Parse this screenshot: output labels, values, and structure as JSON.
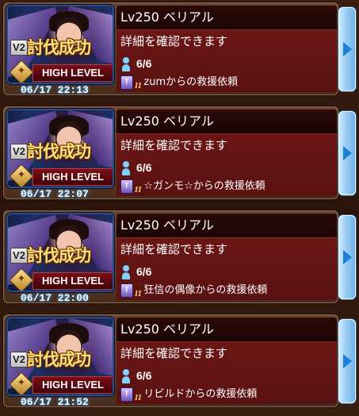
{
  "raids": [
    {
      "title": "Lv250 ベリアル",
      "detail": "詳細を確認できます",
      "participants": "6/6",
      "request": "zumからの救援依頼",
      "time": "06/17 22:13",
      "victory_label": "討伐成功",
      "version_badge": "V2",
      "level_badge": "HIGH LEVEL"
    },
    {
      "title": "Lv250 ベリアル",
      "detail": "詳細を確認できます",
      "participants": "6/6",
      "request": "☆ガンモ☆からの救援依頼",
      "time": "06/17 22:07",
      "victory_label": "討伐成功",
      "version_badge": "V2",
      "level_badge": "HIGH LEVEL"
    },
    {
      "title": "Lv250 ベリアル",
      "detail": "詳細を確認できます",
      "participants": "6/6",
      "request": "狂信の偶像からの救援依頼",
      "time": "06/17 22:00",
      "victory_label": "討伐成功",
      "version_badge": "V2",
      "level_badge": "HIGH LEVEL"
    },
    {
      "title": "Lv250 ベリアル",
      "detail": "詳細を確認できます",
      "participants": "6/6",
      "request": "リビルドからの救援依頼",
      "time": "06/17 21:52",
      "victory_label": "討伐成功",
      "version_badge": "V2",
      "level_badge": "HIGH LEVEL"
    }
  ],
  "icons": {
    "participants": "person-icon",
    "rank": "rank-badge-icon",
    "open": "arrow-right-icon"
  },
  "colors": {
    "time_glow": "#2e8dd6",
    "body_bg": "#6b1615",
    "arrow_button": "#9fd0f5"
  }
}
